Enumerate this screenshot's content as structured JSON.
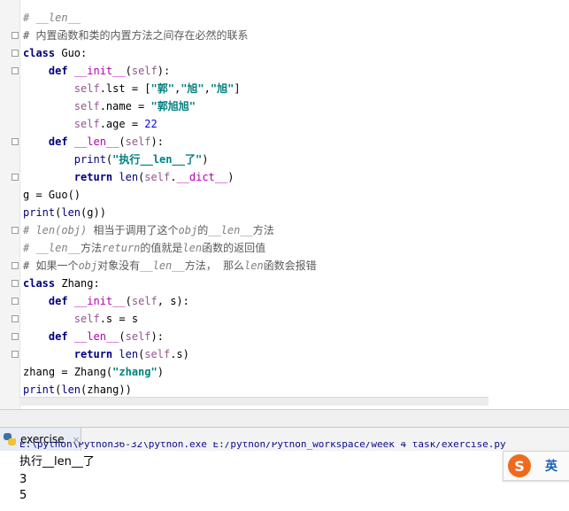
{
  "editor": {
    "lines": [
      [
        {
          "t": "# __len__",
          "c": "cm"
        }
      ],
      [
        {
          "t": "# 内置函数和类的内置方法之间存在必然的联系",
          "c": "cmn"
        }
      ],
      [
        {
          "t": "class ",
          "c": "kw"
        },
        {
          "t": "Guo",
          "c": "cls"
        },
        {
          "t": ":",
          "c": "name"
        }
      ],
      [
        {
          "t": "    "
        },
        {
          "t": "def ",
          "c": "kw"
        },
        {
          "t": "__init__",
          "c": "dunder"
        },
        {
          "t": "(",
          "c": "name"
        },
        {
          "t": "self",
          "c": "self"
        },
        {
          "t": "):",
          "c": "name"
        }
      ],
      [
        {
          "t": "        "
        },
        {
          "t": "self",
          "c": "self"
        },
        {
          "t": ".lst = [",
          "c": "name"
        },
        {
          "t": "\"郭\"",
          "c": "str"
        },
        {
          "t": ",",
          "c": "name"
        },
        {
          "t": "\"旭\"",
          "c": "str"
        },
        {
          "t": ",",
          "c": "name"
        },
        {
          "t": "\"旭\"",
          "c": "str"
        },
        {
          "t": "]",
          "c": "name"
        }
      ],
      [
        {
          "t": "        "
        },
        {
          "t": "self",
          "c": "self"
        },
        {
          "t": ".name = ",
          "c": "name"
        },
        {
          "t": "\"郭旭旭\"",
          "c": "str"
        }
      ],
      [
        {
          "t": "        "
        },
        {
          "t": "self",
          "c": "self"
        },
        {
          "t": ".age = ",
          "c": "name"
        },
        {
          "t": "22",
          "c": "num"
        }
      ],
      [
        {
          "t": "    "
        },
        {
          "t": "def ",
          "c": "kw"
        },
        {
          "t": "__len__",
          "c": "dunder"
        },
        {
          "t": "(",
          "c": "name"
        },
        {
          "t": "self",
          "c": "self"
        },
        {
          "t": "):",
          "c": "name"
        }
      ],
      [
        {
          "t": "        "
        },
        {
          "t": "print",
          "c": "builtin"
        },
        {
          "t": "(",
          "c": "name"
        },
        {
          "t": "\"执行__len__了\"",
          "c": "str"
        },
        {
          "t": ")",
          "c": "name"
        }
      ],
      [
        {
          "t": "        "
        },
        {
          "t": "return ",
          "c": "kw"
        },
        {
          "t": "len",
          "c": "builtin"
        },
        {
          "t": "(",
          "c": "name"
        },
        {
          "t": "self",
          "c": "self"
        },
        {
          "t": ".",
          "c": "name"
        },
        {
          "t": "__dict__",
          "c": "dunder"
        },
        {
          "t": ")",
          "c": "name"
        }
      ],
      [
        {
          "t": "g = Guo()",
          "c": "name"
        }
      ],
      [
        {
          "t": "print",
          "c": "builtin"
        },
        {
          "t": "(",
          "c": "name"
        },
        {
          "t": "len",
          "c": "builtin"
        },
        {
          "t": "(g))",
          "c": "name"
        }
      ],
      [
        {
          "t": "# len(obj) ",
          "c": "cm"
        },
        {
          "t": "相当于调用了这个",
          "c": "cmn"
        },
        {
          "t": "obj",
          "c": "cm"
        },
        {
          "t": "的",
          "c": "cmn"
        },
        {
          "t": "__len__",
          "c": "cm"
        },
        {
          "t": "方法",
          "c": "cmn"
        }
      ],
      [
        {
          "t": "# __len__",
          "c": "cm"
        },
        {
          "t": "方法",
          "c": "cmn"
        },
        {
          "t": "return",
          "c": "cm"
        },
        {
          "t": "的值就是",
          "c": "cmn"
        },
        {
          "t": "len",
          "c": "cm"
        },
        {
          "t": "函数的返回值",
          "c": "cmn"
        }
      ],
      [
        {
          "t": "# 如果一个",
          "c": "cmn"
        },
        {
          "t": "obj",
          "c": "cm"
        },
        {
          "t": "对象没有",
          "c": "cmn"
        },
        {
          "t": "__len__",
          "c": "cm"
        },
        {
          "t": "方法， 那么",
          "c": "cmn"
        },
        {
          "t": "len",
          "c": "cm"
        },
        {
          "t": "函数会报错",
          "c": "cmn"
        }
      ],
      [
        {
          "t": "class ",
          "c": "kw"
        },
        {
          "t": "Zhang",
          "c": "cls"
        },
        {
          "t": ":",
          "c": "name"
        }
      ],
      [
        {
          "t": "    "
        },
        {
          "t": "def ",
          "c": "kw"
        },
        {
          "t": "__init__",
          "c": "dunder"
        },
        {
          "t": "(",
          "c": "name"
        },
        {
          "t": "self",
          "c": "self"
        },
        {
          "t": ", s):",
          "c": "name"
        }
      ],
      [
        {
          "t": "        "
        },
        {
          "t": "self",
          "c": "self"
        },
        {
          "t": ".s = s",
          "c": "name"
        }
      ],
      [
        {
          "t": "    "
        },
        {
          "t": "def ",
          "c": "kw"
        },
        {
          "t": "__len__",
          "c": "dunder"
        },
        {
          "t": "(",
          "c": "name"
        },
        {
          "t": "self",
          "c": "self"
        },
        {
          "t": "):",
          "c": "name"
        }
      ],
      [
        {
          "t": "        "
        },
        {
          "t": "return ",
          "c": "kw"
        },
        {
          "t": "len",
          "c": "builtin"
        },
        {
          "t": "(",
          "c": "name"
        },
        {
          "t": "self",
          "c": "self"
        },
        {
          "t": ".s)",
          "c": "name"
        }
      ],
      [
        {
          "t": "zhang = Zhang(",
          "c": "name"
        },
        {
          "t": "\"zhang\"",
          "c": "str"
        },
        {
          "t": ")",
          "c": "name"
        }
      ],
      [
        {
          "t": "print",
          "c": "builtin"
        },
        {
          "t": "(",
          "c": "name"
        },
        {
          "t": "len",
          "c": "builtin"
        },
        {
          "t": "(zhang))",
          "c": "name"
        }
      ]
    ]
  },
  "run_panel": {
    "tab_label": "exercise",
    "close_symbol": "×",
    "command_line": "E:\\python\\Python36-32\\python.exe E:/python/Python_workspace/week 4 task/exercise.py",
    "output": [
      "执行__len__了",
      "3",
      "5"
    ]
  },
  "ime": {
    "logo_text": "S",
    "lang_label": "英"
  }
}
